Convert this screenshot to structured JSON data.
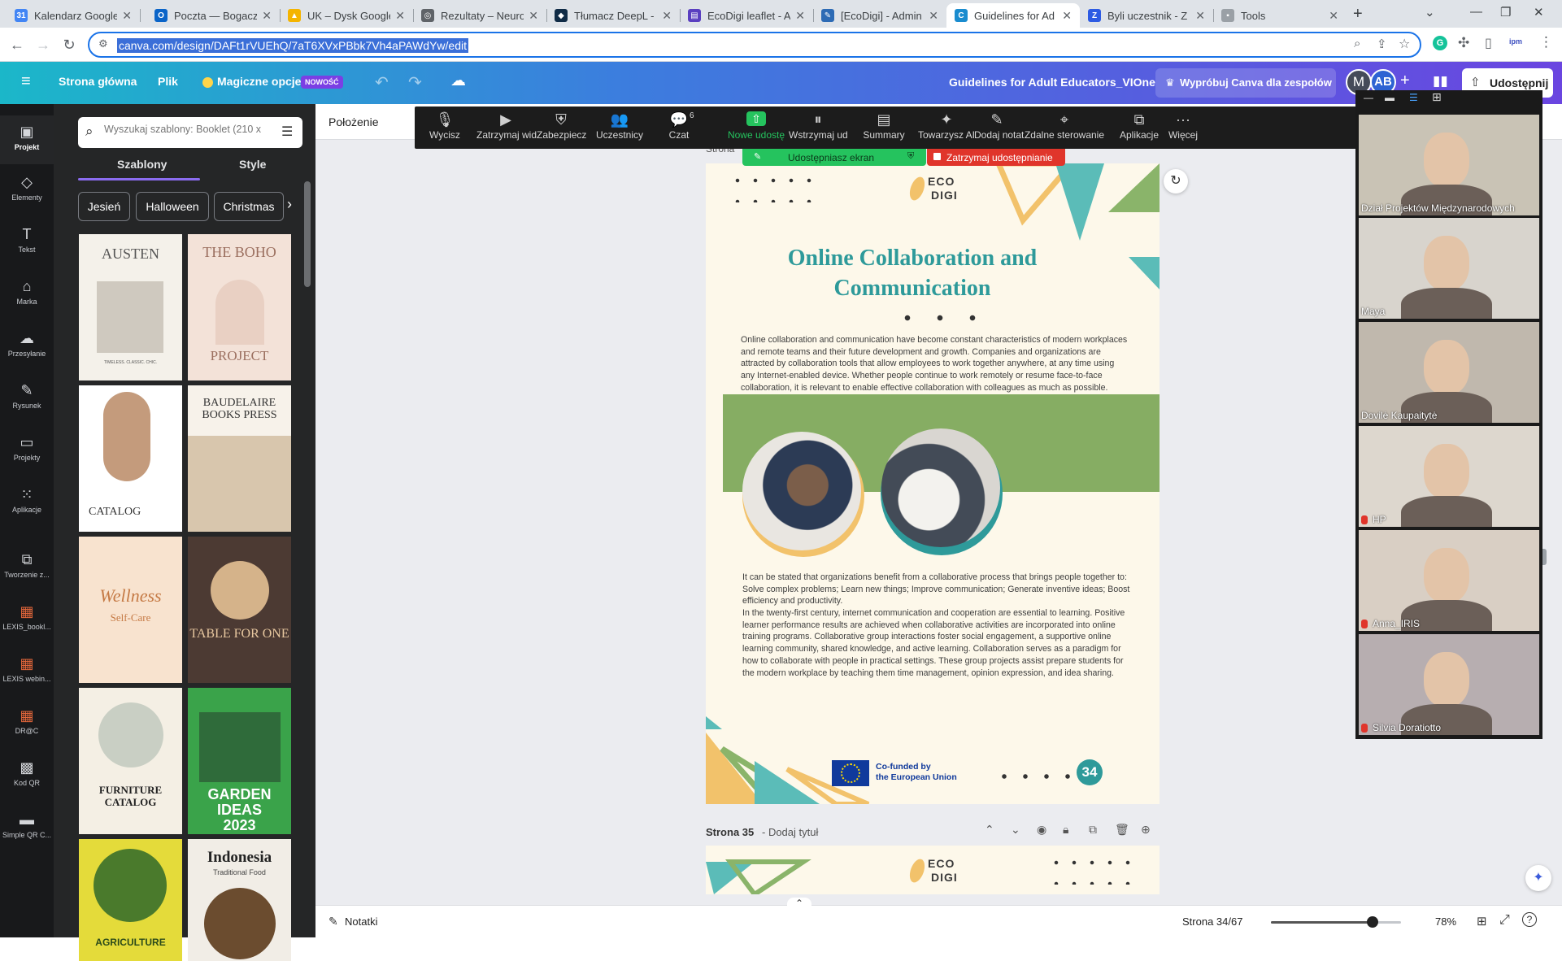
{
  "browser": {
    "tabs": [
      {
        "title": "Kalendarz Google",
        "color": "#4285f4",
        "glyph": "31"
      },
      {
        "title": "Poczta — Bogacz",
        "color": "#0a64c8",
        "glyph": "O"
      },
      {
        "title": "UK – Dysk Google",
        "color": "#f4b400",
        "glyph": "▲"
      },
      {
        "title": "Rezultaty – Neuro",
        "color": "#5f6368",
        "glyph": "◎"
      },
      {
        "title": "Tłumacz DeepL - ",
        "color": "#0f2b46",
        "glyph": "◆"
      },
      {
        "title": "EcoDigi leaflet - A",
        "color": "#5a3fc0",
        "glyph": "▤"
      },
      {
        "title": "[EcoDigi] - Admin",
        "color": "#2d6bb5",
        "glyph": "✎"
      },
      {
        "title": "Guidelines for Ad",
        "color": "#1a8ccf",
        "glyph": "C"
      },
      {
        "title": "Byli uczestnik - Z",
        "color": "#2d5be3",
        "glyph": "Z"
      },
      {
        "title": "Tools",
        "color": "#9aa0a6",
        "glyph": "▪"
      }
    ],
    "new_tab": "+",
    "url": "canva.com/design/DAFt1rVUEhQ/7aT6XVxPBbk7Vh4aPAWdYw/edit"
  },
  "header": {
    "home": "Strona główna",
    "file": "Plik",
    "magic": "Magiczne opcje",
    "magic_badge": "NOWOŚĆ",
    "title": "Guidelines for Adult Educators_VIOne",
    "teams": "Wypróbuj Canva dla zespołów",
    "avatar1": "M",
    "avatar2": "AB",
    "share": "Udostępnij"
  },
  "rail": [
    {
      "label": "Projekt",
      "icon": "▣"
    },
    {
      "label": "Elementy",
      "icon": "◇"
    },
    {
      "label": "Tekst",
      "icon": "T"
    },
    {
      "label": "Marka",
      "icon": "⌂"
    },
    {
      "label": "Przesyłanie",
      "icon": "☁"
    },
    {
      "label": "Rysunek",
      "icon": "✎"
    },
    {
      "label": "Projekty",
      "icon": "▭"
    },
    {
      "label": "Aplikacje",
      "icon": "⁙"
    },
    {
      "label": "Tworzenie z...",
      "icon": "⧉"
    },
    {
      "label": "LEXIS_bookl...",
      "icon": "▦"
    },
    {
      "label": "LEXIS webin...",
      "icon": "▦"
    },
    {
      "label": "DR@C",
      "icon": "▦"
    },
    {
      "label": "Kod QR",
      "icon": "▩"
    },
    {
      "label": "Simple QR C...",
      "icon": "▬"
    }
  ],
  "panel": {
    "search_placeholder": "Wyszukaj szablony: Booklet (210 x",
    "tab_templates": "Szablony",
    "tab_styles": "Style",
    "chips": [
      "Jesień",
      "Halloween",
      "Christmas"
    ],
    "thumbs": [
      {
        "title": "AUSTEN",
        "sub": "TIMELESS. CLASSIC. CHIC."
      },
      {
        "title": "THE BOHO",
        "sub": "PROJECT"
      },
      {
        "title": "CATALOG",
        "sub": ""
      },
      {
        "title": "BAUDELAIRE BOOKS PRESS",
        "sub": ""
      },
      {
        "title": "Wellness",
        "sub": "Self-Care"
      },
      {
        "title": "TABLE FOR ONE",
        "sub": ""
      },
      {
        "title": "FURNITURE CATALOG",
        "sub": ""
      },
      {
        "title": "GARDEN IDEAS 2023",
        "sub": ""
      },
      {
        "title": "AGRICULTURE",
        "sub": ""
      },
      {
        "title": "Indonesia",
        "sub": "Traditional Food"
      }
    ]
  },
  "context": {
    "position": "Położenie",
    "page_label_prefix": "Strona"
  },
  "zoom": {
    "items": [
      {
        "label": "Wycisz",
        "icon": "🎙"
      },
      {
        "label": "Zatrzymaj wid",
        "icon": "▶"
      },
      {
        "label": "Zabezpiecz",
        "icon": "⛨"
      },
      {
        "label": "Uczestnicy",
        "icon": "👥"
      },
      {
        "label": "Czat",
        "icon": "💬"
      },
      {
        "label": "Nowe udostę",
        "icon": "⇧"
      },
      {
        "label": "Wstrzymaj ud",
        "icon": "⏸"
      },
      {
        "label": "Summary",
        "icon": "▤"
      },
      {
        "label": "Towarzysz AI",
        "icon": "✦"
      },
      {
        "label": "Dodaj notat",
        "icon": "✎"
      },
      {
        "label": "Zdalne sterowanie",
        "icon": "⌖"
      },
      {
        "label": "Aplikacje",
        "icon": "⧉"
      },
      {
        "label": "Więcej",
        "icon": "···"
      }
    ],
    "participants_count": "6",
    "sharing": "Udostępniasz ekran",
    "stop_sharing": "Zatrzymaj udostępnianie"
  },
  "page": {
    "logo_top": "ECO",
    "logo_bottom": "DIGI",
    "title_line1": "Online Collaboration and",
    "title_line2": "Communication",
    "para1": "Online collaboration and communication have become constant characteristics of modern workplaces and remote teams and their future development and growth. Companies and organizations are attracted by collaboration tools that allow employees to work together anywhere, at any time using any Internet-enabled device. Whether people continue to work remotely or resume face-to-face collaboration, it is relevant to enable effective collaboration with colleagues as much as possible.",
    "para2": "It can be stated that organizations benefit from a collaborative process that brings people together to: Solve complex problems; Learn new things; Improve communication; Generate inventive ideas; Boost efficiency and productivity.",
    "para3": "In the twenty-first century, internet communication and cooperation are essential to learning. Positive learner performance results are achieved when collaborative activities are incorporated into online training programs. Collaborative group interactions foster social engagement, a supportive online learning community, shared knowledge, and active learning. Collaboration serves as a paradigm for how to collaborate with people in practical settings. These group projects assist prepare students for the modern workplace by teaching them time management, opinion expression, and idea sharing.",
    "eu_line1": "Co-funded by",
    "eu_line2": "the European Union",
    "page_number": "34"
  },
  "next_page": {
    "label": "Strona 35",
    "add_title": "- Dodaj tytuł"
  },
  "videos": [
    {
      "name": "Dział Projektów Międzynarodowych",
      "bg": "#c9c3b5"
    },
    {
      "name": "Maya",
      "bg": "#d8d4cd"
    },
    {
      "name": "Dovilė Kaupaitytė",
      "bg": "#c0b8ad"
    },
    {
      "name": "HP",
      "bg": "#ddd7ce"
    },
    {
      "name": "Anna_IRIS",
      "bg": "#d9cfc4"
    },
    {
      "name": "Silvia Doratiotto",
      "bg": "#b7aeb0"
    }
  ],
  "bottom": {
    "notes": "Notatki",
    "page_counter": "Strona 34/67",
    "zoom_pct": "78%",
    "zoom_level": 0.78
  }
}
